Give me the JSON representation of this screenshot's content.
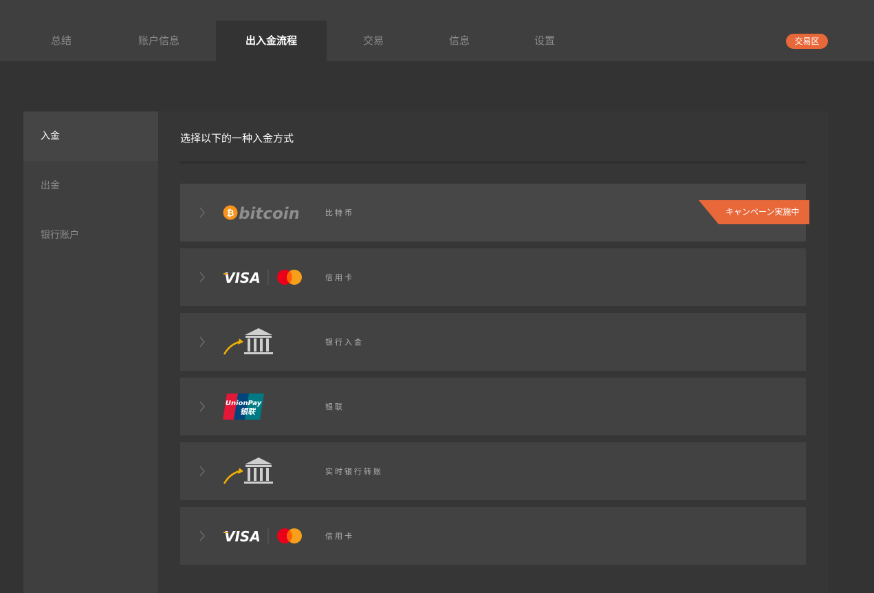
{
  "nav": {
    "tabs": [
      {
        "label": "总结"
      },
      {
        "label": "账户信息"
      },
      {
        "label": "出入金流程"
      },
      {
        "label": "交易"
      },
      {
        "label": "信息"
      },
      {
        "label": "设置"
      }
    ],
    "zone_badge": "交易区"
  },
  "sidebar": {
    "items": [
      {
        "label": "入金"
      },
      {
        "label": "出金"
      },
      {
        "label": "银行账户"
      }
    ]
  },
  "main": {
    "title": "选择以下的一种入金方式",
    "methods": [
      {
        "label": "比特币",
        "logo_icon": "bitcoin-logo",
        "logo_text": "bitcoin",
        "badge": "キャンペーン実施中"
      },
      {
        "label": "信用卡",
        "logo_icon": "visa-mastercard-logo",
        "logo_text": "VISA"
      },
      {
        "label": "银行入金",
        "logo_icon": "bank-building-icon"
      },
      {
        "label": "银联",
        "logo_icon": "unionpay-logo",
        "logo_text_top": "UnionPay",
        "logo_text_bottom": "银联"
      },
      {
        "label": "实时银行转账",
        "logo_icon": "bank-building-icon"
      },
      {
        "label": "信用卡",
        "logo_icon": "visa-mastercard-logo",
        "logo_text": "VISA"
      }
    ]
  },
  "colors": {
    "accent": "#e8683a",
    "nav_background": "#3f3f3f",
    "page_background": "#333333",
    "row_background": "#424242"
  }
}
